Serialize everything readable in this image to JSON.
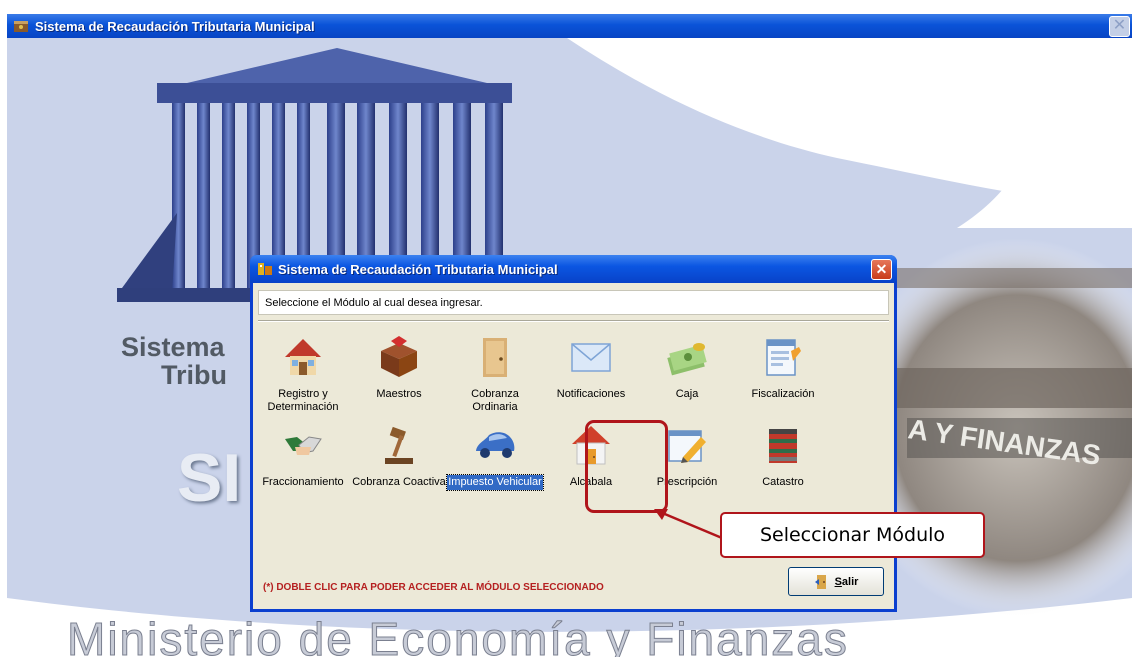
{
  "main_window": {
    "title": "Sistema de Recaudación Tributaria Municipal",
    "bg_text_line1": "Sistema",
    "bg_text_line2": "Tribu",
    "bg_big_text": "SI",
    "bg_footer_text": "Ministerio de Economía y Finanzas",
    "bg_sign_text": "A Y FINANZAS"
  },
  "dialog": {
    "title": "Sistema de Recaudación Tributaria Municipal",
    "close_label": "✕",
    "instruction": "Seleccione el Módulo al cual desea ingresar.",
    "modules": [
      {
        "label": "Registro y Determinación",
        "icon": "house-icon"
      },
      {
        "label": "Maestros",
        "icon": "box-icon"
      },
      {
        "label": "Cobranza Ordinaria",
        "icon": "door-icon"
      },
      {
        "label": "Notificaciones",
        "icon": "envelope-icon"
      },
      {
        "label": "Caja",
        "icon": "money-icon"
      },
      {
        "label": "Fiscalización",
        "icon": "form-edit-icon"
      },
      {
        "label": "Fraccionamiento",
        "icon": "handshake-icon"
      },
      {
        "label": "Cobranza Coactiva",
        "icon": "gavel-icon"
      },
      {
        "label": "Impuesto Vehicular",
        "icon": "car-icon",
        "selected": true
      },
      {
        "label": "Alcabala",
        "icon": "house-door-icon"
      },
      {
        "label": "Prescripción",
        "icon": "pencil-edit-icon"
      },
      {
        "label": "Catastro",
        "icon": "building-icon"
      }
    ],
    "hint": "(*) DOBLE CLIC PARA PODER ACCEDER AL MÓDULO SELECCIONADO",
    "salir_label": "Salir",
    "salir_mnemonic": "S",
    "salir_rest": "alir"
  },
  "annotation": {
    "callout_text": "Seleccionar Módulo",
    "color": "#b0151b"
  }
}
